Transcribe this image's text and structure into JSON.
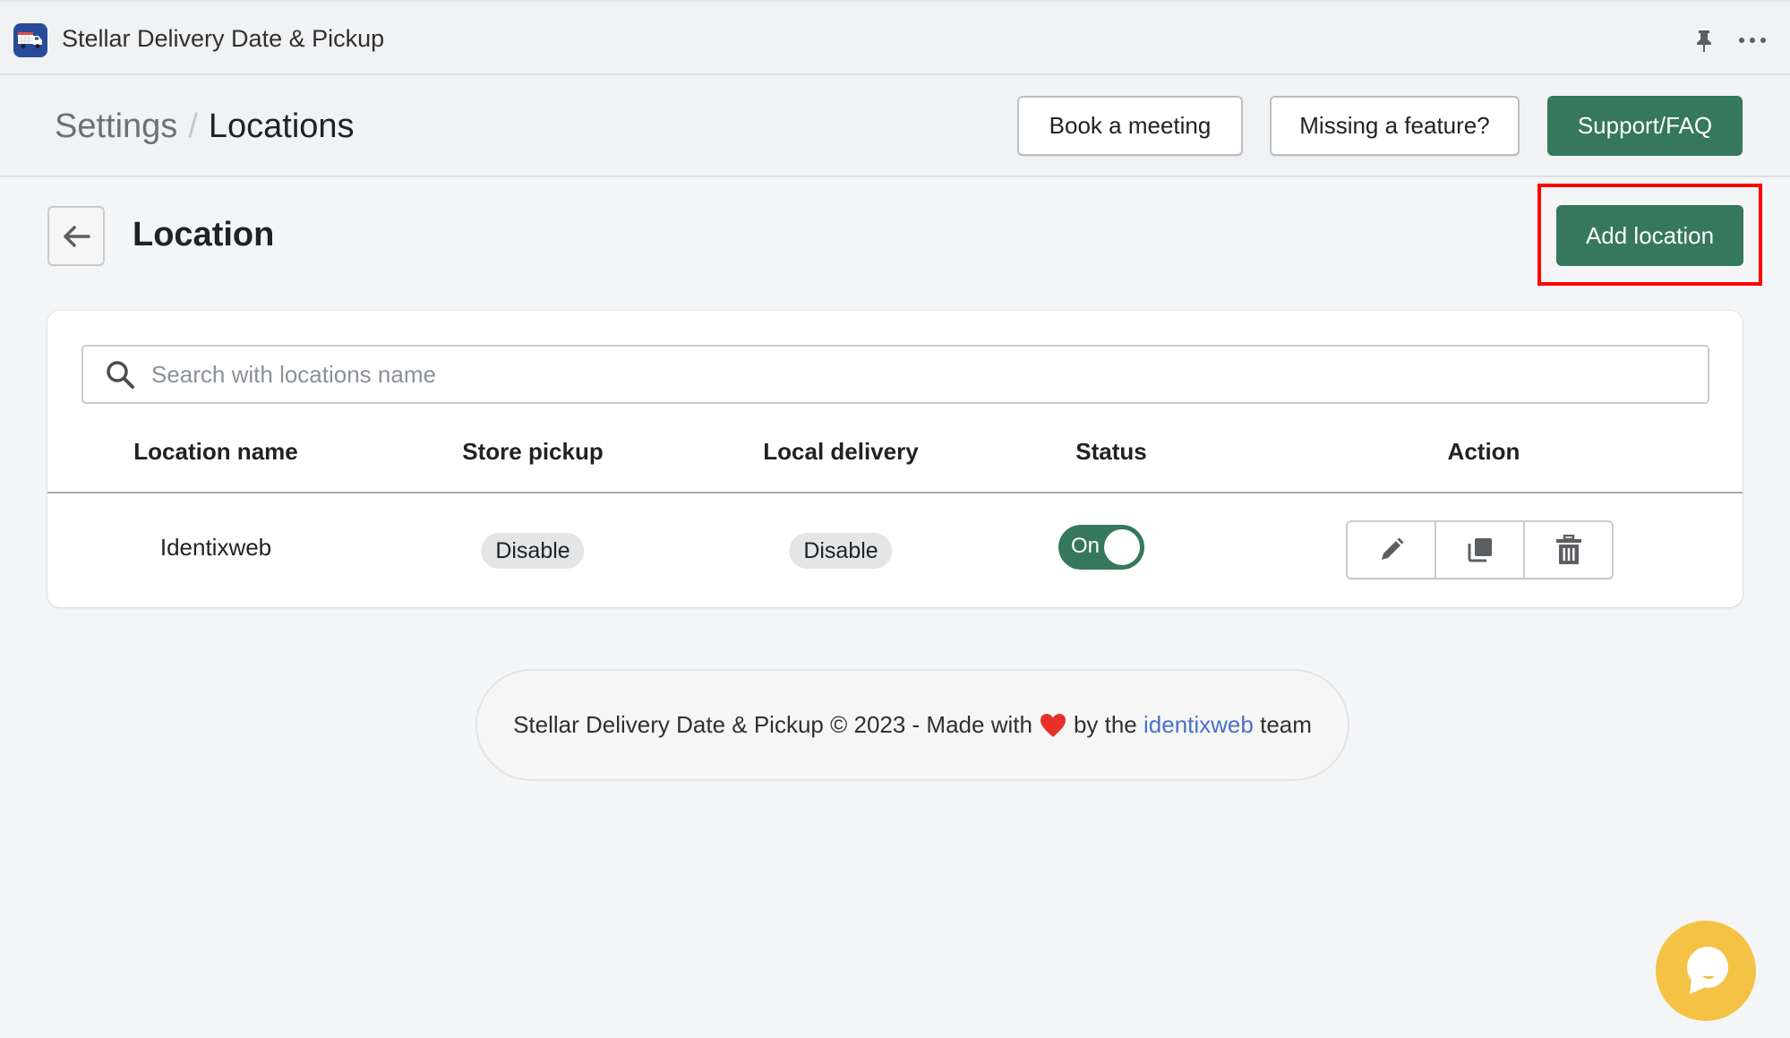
{
  "app": {
    "title": "Stellar Delivery Date & Pickup",
    "icon": "delivery-truck-icon"
  },
  "topbar_actions": {
    "pin_icon": "pin-icon",
    "more_icon": "more-horizontal-icon"
  },
  "breadcrumb": {
    "parent": "Settings",
    "separator": "/",
    "current": "Locations"
  },
  "header_buttons": {
    "book_meeting": "Book a meeting",
    "missing_feature": "Missing a feature?",
    "support": "Support/FAQ"
  },
  "page": {
    "title": "Location",
    "back_icon": "arrow-left-icon",
    "add_button": "Add location"
  },
  "search": {
    "placeholder": "Search with locations name",
    "value": ""
  },
  "table": {
    "columns": [
      "Location name",
      "Store pickup",
      "Local delivery",
      "Status",
      "Action"
    ],
    "rows": [
      {
        "location_name": "Identixweb",
        "store_pickup": "Disable",
        "local_delivery": "Disable",
        "status": "On",
        "status_on": true,
        "actions": [
          "edit-icon",
          "duplicate-icon",
          "delete-icon"
        ]
      }
    ]
  },
  "footer": {
    "prefix": "Stellar Delivery Date & Pickup © 2023 - Made with",
    "middle": "by the",
    "link": "identixweb",
    "suffix": "team"
  },
  "colors": {
    "primary_green": "#35785c",
    "highlight_red": "#ff0000",
    "chat_yellow": "#f4c244",
    "link_blue": "#4b6fc5",
    "heart_red": "#e8302a"
  }
}
